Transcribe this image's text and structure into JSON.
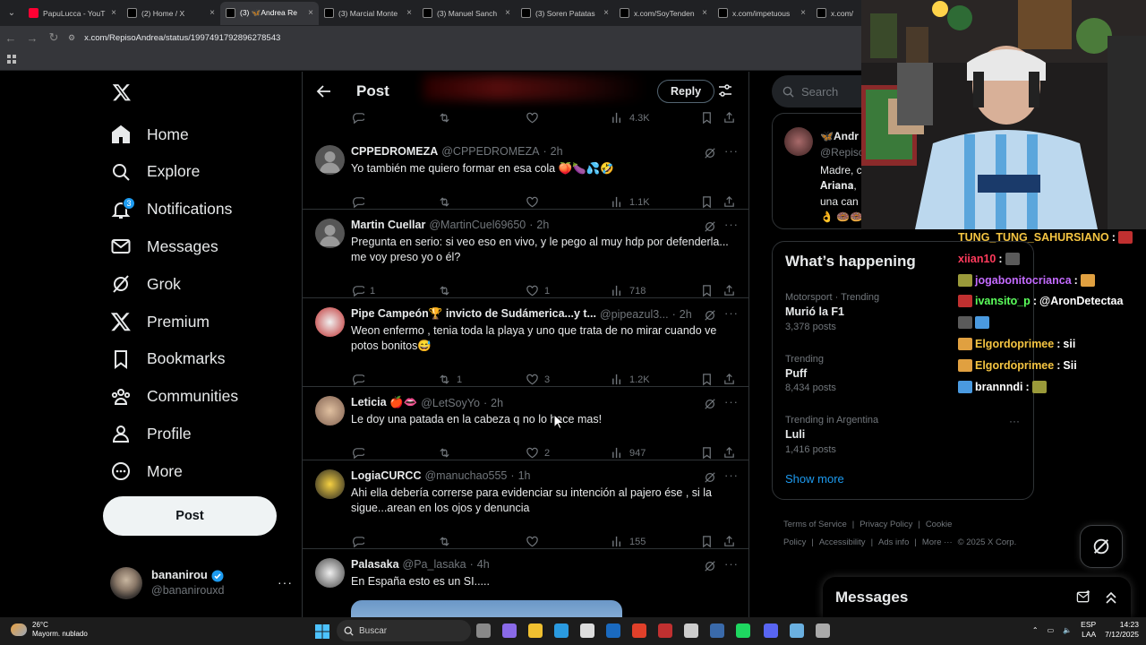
{
  "browser": {
    "tabs": [
      {
        "label": "PapuLucca - YouT",
        "color": "#ff0033"
      },
      {
        "label": "(2) Home / X",
        "color": "#000000"
      },
      {
        "label": "(3) 🦋Andrea Re",
        "color": "#000000",
        "active": true
      },
      {
        "label": "(3) Marcial Monte",
        "color": "#000000"
      },
      {
        "label": "(3) Manuel Sanch",
        "color": "#000000"
      },
      {
        "label": "(3) Soren Patatas",
        "color": "#000000"
      },
      {
        "label": "x.com/SoyTenden",
        "color": "#000000"
      },
      {
        "label": "x.com/impetuous",
        "color": "#000000"
      },
      {
        "label": "x.com/",
        "color": "#000000"
      }
    ],
    "url": "x.com/RepisoAndrea/status/1997491792896278543"
  },
  "sidebar": {
    "items": [
      {
        "label": "Home",
        "icon": "home-icon"
      },
      {
        "label": "Explore",
        "icon": "search-icon"
      },
      {
        "label": "Notifications",
        "icon": "bell-icon",
        "badge": "3"
      },
      {
        "label": "Messages",
        "icon": "envelope-icon"
      },
      {
        "label": "Grok",
        "icon": "grok-icon"
      },
      {
        "label": "Premium",
        "icon": "x-logo-icon"
      },
      {
        "label": "Bookmarks",
        "icon": "bookmark-icon"
      },
      {
        "label": "Communities",
        "icon": "people-icon"
      },
      {
        "label": "Profile",
        "icon": "person-icon"
      },
      {
        "label": "More",
        "icon": "more-circle-icon"
      }
    ],
    "post_label": "Post",
    "user": {
      "display_name": "bananirou",
      "handle": "@bananirouxd"
    }
  },
  "main": {
    "title": "Post",
    "reply_label": "Reply",
    "top_actions": {
      "views": "4.3K"
    },
    "tweets": [
      {
        "name": "CPPEDROMEZA",
        "handle": "@CPPEDROMEZA",
        "time": "2h",
        "text": "Yo también me quiero formar en esa cola 🍑🍆💦🤣",
        "replies": "",
        "reposts": "",
        "likes": "",
        "views": "1.1K"
      },
      {
        "name": "Martin Cuellar",
        "handle": "@MartinCuel69650",
        "time": "2h",
        "text": "Pregunta en serio: si veo eso en vivo, y le pego al muy hdp por defenderla... me voy preso yo o él?",
        "replies": "1",
        "reposts": "",
        "likes": "1",
        "views": "718"
      },
      {
        "name": "Pipe Campeón🏆 invicto de Sudámerica...y t...",
        "handle": "@pipeazul3...",
        "time": "2h",
        "text": "Weon enfermo , tenia toda la playa y uno que trata de no mirar cuando ve potos bonitos😅",
        "replies": "",
        "reposts": "1",
        "likes": "3",
        "views": "1.2K"
      },
      {
        "name": "Leticia 🍎👄",
        "handle": "@LetSoyYo",
        "time": "2h",
        "text": "Le doy una patada en la cabeza q no lo hace mas!",
        "replies": "",
        "reposts": "",
        "likes": "2",
        "views": "947"
      },
      {
        "name": "LogiaCURCC",
        "handle": "@manuchao555",
        "time": "1h",
        "text": "Ahi ella debería correrse para evidenciar su intención al pajero ése , si la sigue...arean en los ojos y denuncia",
        "replies": "",
        "reposts": "",
        "likes": "",
        "views": "155"
      },
      {
        "name": "Palasaka",
        "handle": "@Pa_lasaka",
        "time": "4h",
        "text": "En España esto es un SI.....",
        "replies": "",
        "reposts": "",
        "likes": "",
        "views": ""
      }
    ]
  },
  "right": {
    "search_placeholder": "Search",
    "mini_post": {
      "name": "🦋Andr",
      "handle": "@Repiso",
      "line1": "Madre, c",
      "line2": "𝐀𝐫𝐢𝐚𝐧𝐚,",
      "line3": "una can",
      "line4": "👌 🍩🍩"
    },
    "happening_title": "What’s happening",
    "trends": [
      {
        "context": "Motorsport · Trending",
        "name": "Murió la F1",
        "count": "3,378 posts"
      },
      {
        "context": "Trending",
        "name": "Puff",
        "count": "8,434 posts"
      },
      {
        "context": "Trending in Argentina",
        "name": "Luli",
        "count": "1,416 posts"
      }
    ],
    "show_more": "Show more",
    "footer": [
      "Terms of Service",
      "|",
      "Privacy Policy",
      "|",
      "Cookie Policy",
      "|",
      "Accessibility",
      "|",
      "Ads info",
      "|",
      "More ···",
      "© 2025 X Corp."
    ],
    "messages_title": "Messages"
  },
  "stream_chat": [
    {
      "user": "TUNG_TUNG_SAHURSIANO",
      "color": "#f5c542",
      "msg": ""
    },
    {
      "user": "xiian10",
      "color": "#ff3b5c",
      "msg": ""
    },
    {
      "user": "jogabonitocrianca",
      "color": "#c46bff",
      "msg": ""
    },
    {
      "user": "ivansito_p",
      "color": "#5bff5b",
      "msg": "@AronDetectaa"
    },
    {
      "user": "",
      "color": "#ffffff",
      "msg": ""
    },
    {
      "user": "Elgordoprimee",
      "color": "#f5c542",
      "msg": "sii"
    },
    {
      "user": "Elgordoprimee",
      "color": "#f5c542",
      "msg": "Sii"
    },
    {
      "user": "brannndi",
      "color": "#ffffff",
      "msg": ""
    }
  ],
  "taskbar": {
    "temp": "26°C",
    "weather": "Mayorm. nublado",
    "search": "Buscar",
    "lang1": "ESP",
    "lang2": "LAA",
    "time": "14:23",
    "date": "7/12/2025"
  }
}
